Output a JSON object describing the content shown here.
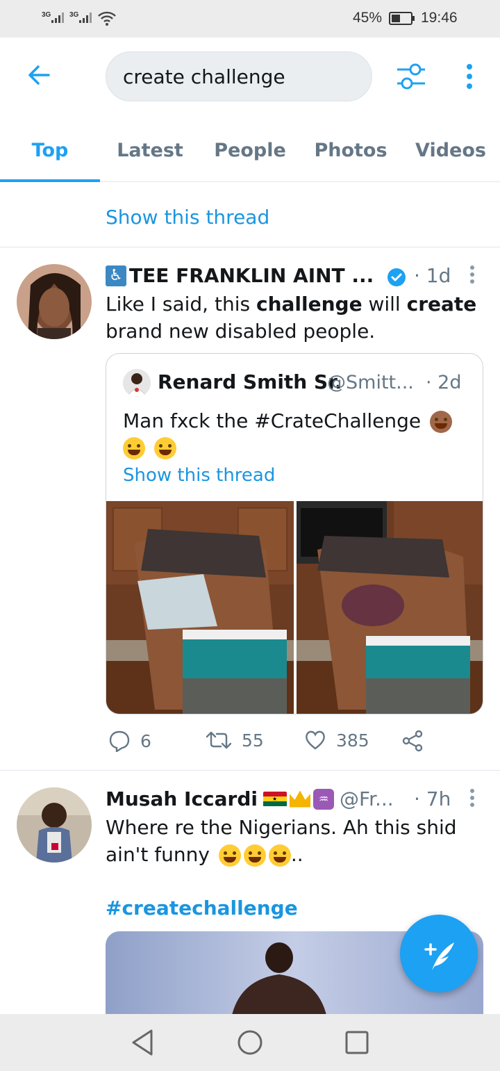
{
  "status_bar": {
    "signal1": "3G",
    "signal2": "3G",
    "battery": "45%",
    "time": "19:46"
  },
  "search": {
    "query": "create challenge"
  },
  "tabs": [
    {
      "label": "Top",
      "active": true
    },
    {
      "label": "Latest",
      "active": false
    },
    {
      "label": "People",
      "active": false
    },
    {
      "label": "Photos",
      "active": false
    },
    {
      "label": "Videos",
      "active": false
    }
  ],
  "thread_link": "Show this thread",
  "tweet1": {
    "name_icon": "♿",
    "name": "TEE FRANKLIN AINT ...",
    "verified": true,
    "time": "· 1d",
    "text_parts": {
      "p1": "Like I said, this ",
      "b1": "challenge",
      "p2": " will ",
      "b2": "create",
      "p3": "brand new disabled people."
    },
    "quote": {
      "name": "Renard Smith Sr.",
      "handle": "@Smitt...",
      "time": "· 2d",
      "text": "Man fxck the #CrateChallenge",
      "show_thread": "Show this thread"
    },
    "actions": {
      "replies": "6",
      "retweets": "55",
      "likes": "385"
    }
  },
  "tweet2": {
    "name": "Musah Iccardi",
    "handle": "@Fr...",
    "time": "· 7h",
    "text_line1": "Where re the Nigerians. Ah this shid",
    "text_line2": "ain't funny",
    "text_tail": "..",
    "hashtag": "#createchallenge"
  },
  "colors": {
    "accent": "#1da1f2",
    "link": "#1b95e0",
    "muted": "#657786"
  },
  "icons": [
    "back-arrow-icon",
    "filter-icon",
    "more-vertical-icon",
    "verified-icon",
    "reply-icon",
    "retweet-icon",
    "like-icon",
    "share-icon",
    "compose-tweet-icon",
    "nav-back-icon",
    "nav-home-icon",
    "nav-recents-icon"
  ]
}
